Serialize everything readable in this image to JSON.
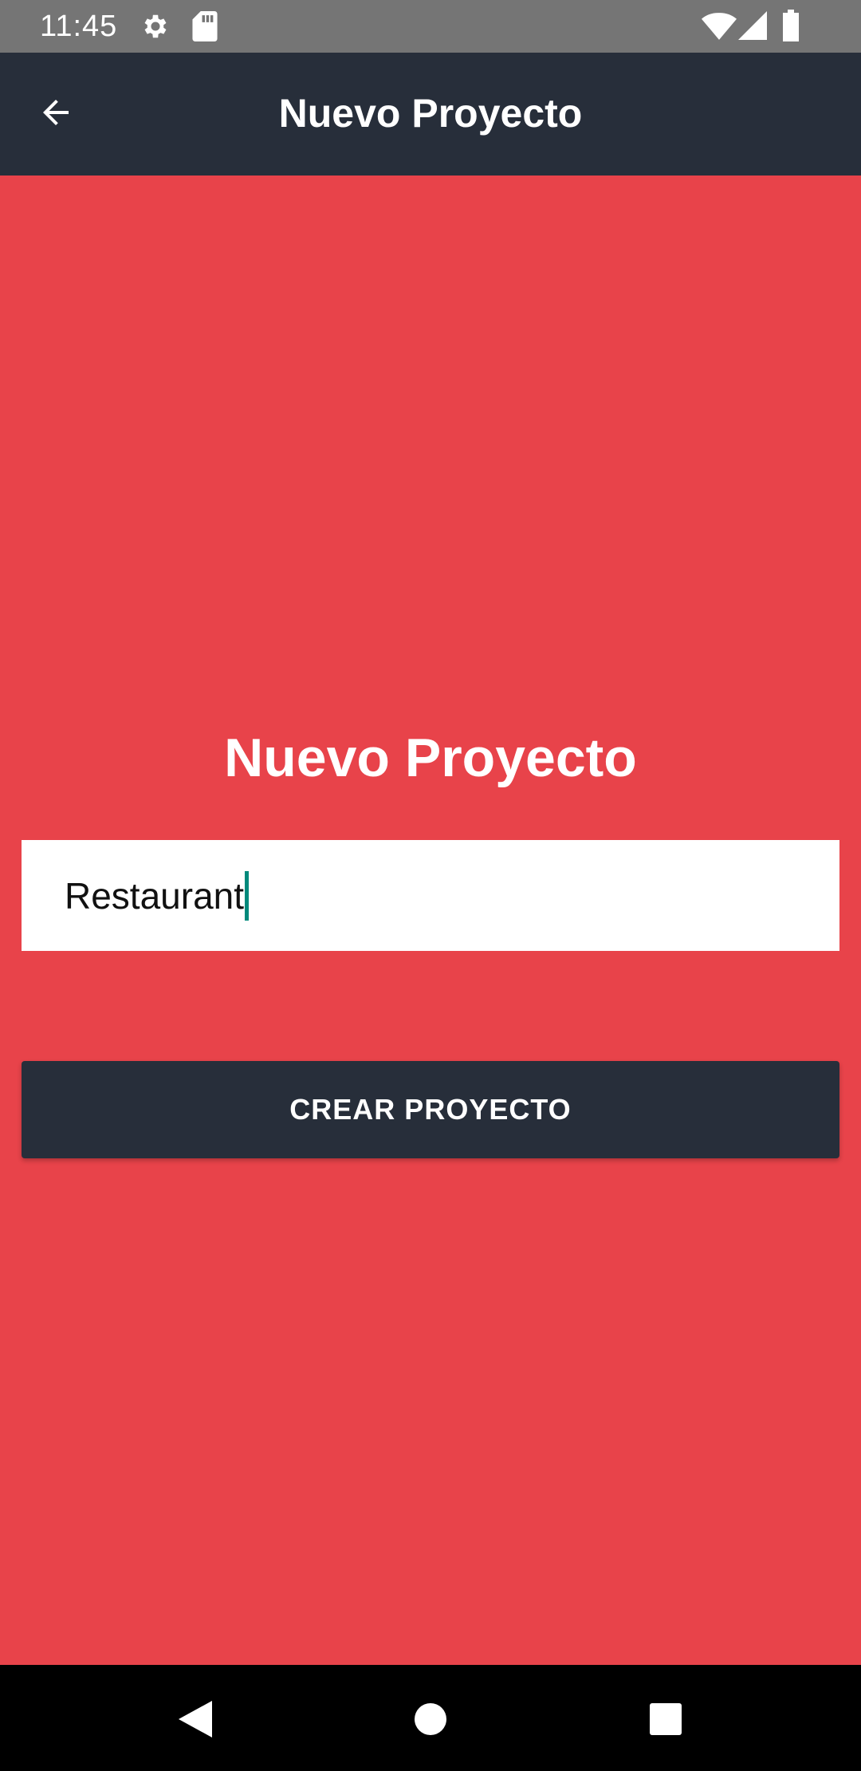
{
  "status_bar": {
    "time": "11:45",
    "icons": [
      "settings-icon",
      "sd-card-icon",
      "wifi-icon",
      "cell-signal-icon",
      "battery-icon"
    ]
  },
  "app_bar": {
    "title": "Nuevo Proyecto",
    "back_icon": "arrow-back-icon"
  },
  "main": {
    "heading": "Nuevo Proyecto",
    "project_name_input": {
      "value": "Restaurant"
    },
    "create_button_label": "CREAR PROYECTO"
  },
  "nav_bar": {
    "buttons": [
      "back-triangle-icon",
      "home-circle-icon",
      "recents-square-icon"
    ]
  },
  "colors": {
    "background": "#E8434A",
    "app_bar": "#272E3A",
    "button": "#272E3A",
    "status_bar": "#757575",
    "cursor": "#00897B"
  }
}
